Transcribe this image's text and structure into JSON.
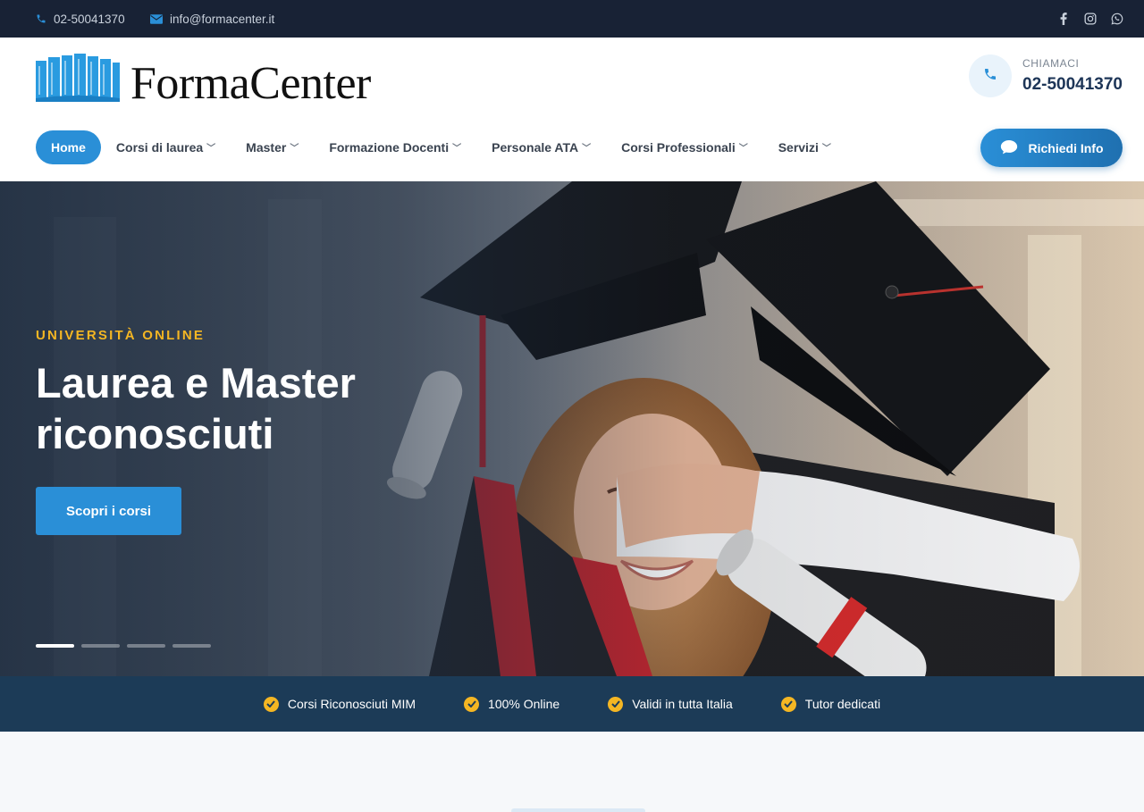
{
  "topbar": {
    "phone": "02-50041370",
    "email": "info@formacenter.it",
    "socials": [
      "facebook-icon",
      "instagram-icon",
      "whatsapp-icon"
    ]
  },
  "header": {
    "logo_text": "FormaCenter",
    "call_label": "CHIAMACI",
    "call_number": "02-50041370",
    "cta_label": "Richiedi Info"
  },
  "nav": {
    "items": [
      {
        "label": "Home",
        "active": true
      },
      {
        "label": "Corsi di laurea",
        "dropdown": true
      },
      {
        "label": "Master",
        "dropdown": true
      },
      {
        "label": "Formazione Docenti",
        "dropdown": true
      },
      {
        "label": "Personale ATA",
        "dropdown": true
      },
      {
        "label": "Corsi Professionali",
        "dropdown": true
      },
      {
        "label": "Servizi",
        "dropdown": true
      }
    ]
  },
  "hero": {
    "eyebrow": "UNIVERSITÀ ONLINE",
    "title_line1": "Laurea e Master",
    "title_line2": "riconosciuti",
    "button": "Scopri i corsi",
    "slides": 4,
    "active_slide": 1
  },
  "features": [
    "Corsi Riconosciuti MIM",
    "100% Online",
    "Validi in tutta Italia",
    "Tutor dedicati"
  ],
  "colors": {
    "primary": "#2a8fd7",
    "dark": "#182235",
    "navy": "#1c3b57",
    "accent": "#f4b623"
  }
}
